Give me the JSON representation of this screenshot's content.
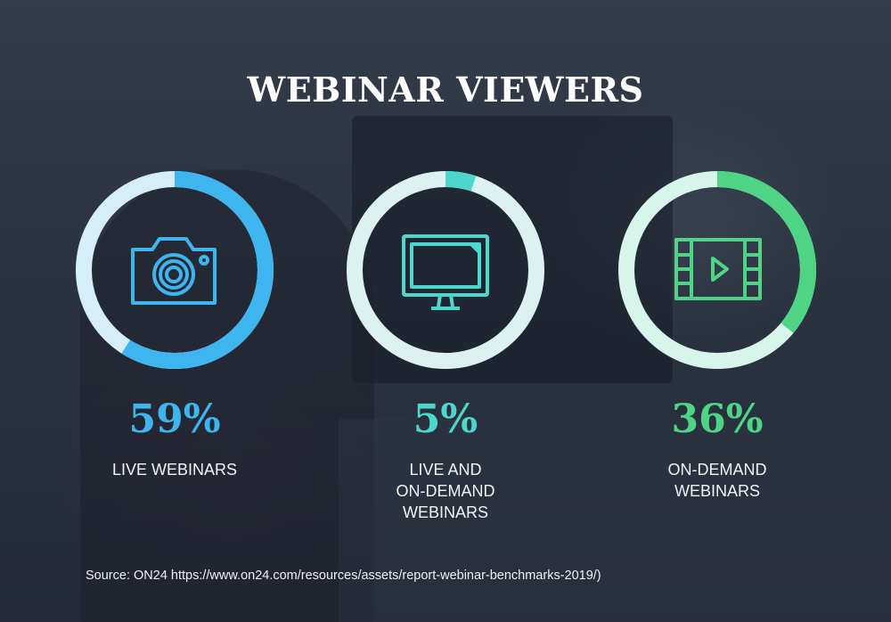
{
  "title": "WEBINAR VIEWERS",
  "source": "Source: ON24 https://www.on24.com/resources/assets/report-webinar-benchmarks-2019/)",
  "chart_data": {
    "type": "pie",
    "title": "WEBINAR VIEWERS",
    "categories": [
      "LIVE WEBINARS",
      "LIVE AND ON-DEMAND WEBINARS",
      "ON-DEMAND WEBINARS"
    ],
    "values": [
      59,
      5,
      36
    ],
    "unit": "%",
    "items": [
      {
        "value": 59,
        "value_label": "59%",
        "label_lines": [
          "LIVE WEBINARS"
        ],
        "color": "#3fb5f0",
        "track": "#d6eef9",
        "icon": "camera-icon"
      },
      {
        "value": 5,
        "value_label": "5%",
        "label_lines": [
          "LIVE AND",
          "ON-DEMAND",
          "WEBINARS"
        ],
        "color": "#4fd6cc",
        "track": "#dcf2f0",
        "icon": "monitor-icon"
      },
      {
        "value": 36,
        "value_label": "36%",
        "label_lines": [
          "ON-DEMAND",
          "WEBINARS"
        ],
        "color": "#4fd486",
        "track": "#d8f5ec",
        "icon": "video-icon"
      }
    ]
  }
}
